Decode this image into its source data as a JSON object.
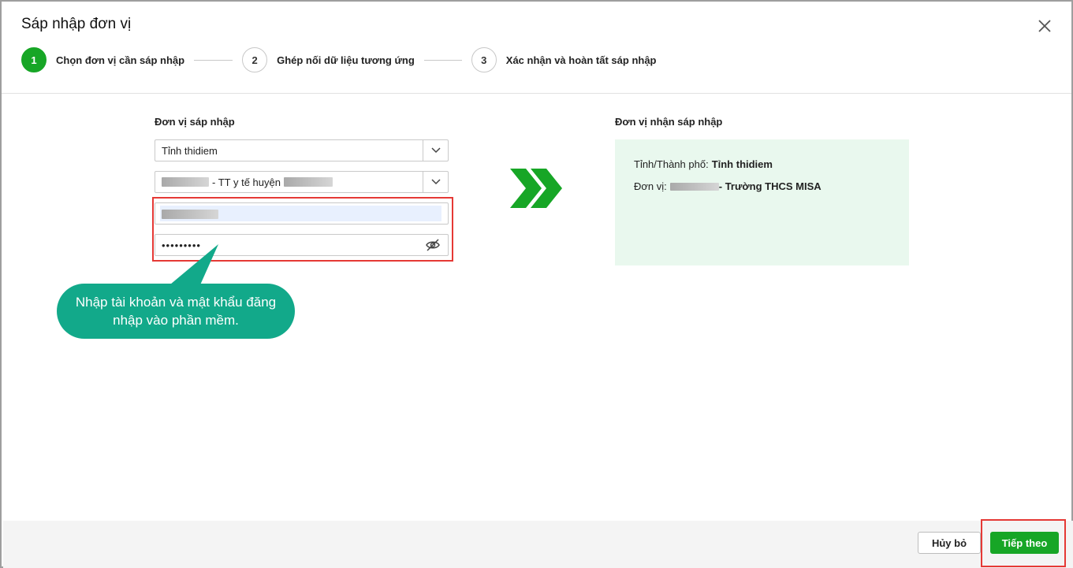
{
  "dialog": {
    "title": "Sáp nhập đơn vị",
    "close_icon": "close-icon"
  },
  "steps": [
    {
      "number": "1",
      "label": "Chọn đơn vị cần sáp nhập",
      "active": true
    },
    {
      "number": "2",
      "label": "Ghép nối dữ liệu tương ứng",
      "active": false
    },
    {
      "number": "3",
      "label": "Xác nhận và hoàn tất sáp nhập",
      "active": false
    }
  ],
  "source": {
    "label": "Đơn vị sáp nhập",
    "province_select": "Tỉnh thidiem",
    "unit_select_text": "- TT y tế huyện",
    "password_value": "•••••••••"
  },
  "callout": {
    "text": "Nhập tài khoản và mật khẩu đăng nhập vào phần mềm."
  },
  "target": {
    "label": "Đơn vị nhận sáp nhập",
    "province_label": "Tỉnh/Thành phố:",
    "province_value": "Tỉnh thidiem",
    "unit_label": "Đơn vị:",
    "unit_value": "- Trường THCS MISA"
  },
  "footer": {
    "cancel_label": "Hủy bỏ",
    "next_label": "Tiếp theo"
  },
  "colors": {
    "accent_green": "#17a626",
    "callout_teal": "#12a98a",
    "highlight_red": "#e53935",
    "target_bg": "#e9f8ee"
  }
}
